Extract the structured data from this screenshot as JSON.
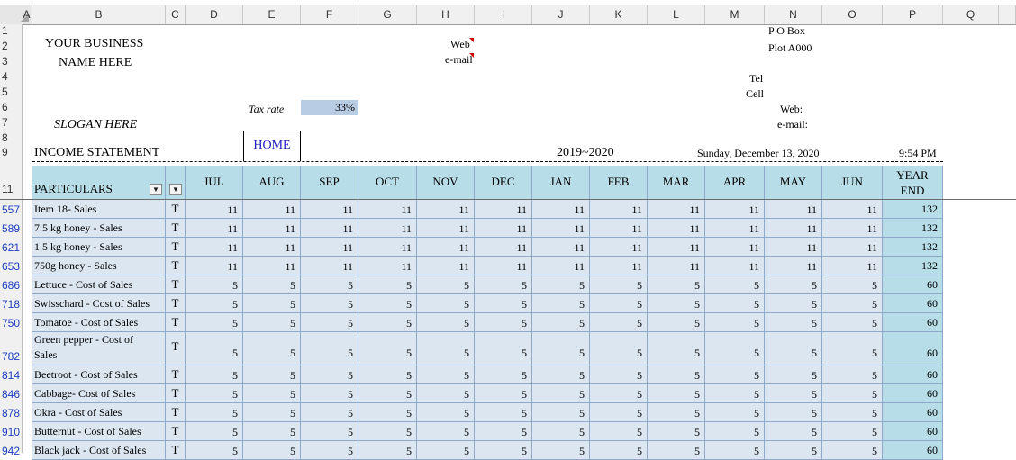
{
  "column_headers": [
    "A",
    "B",
    "C",
    "D",
    "E",
    "F",
    "G",
    "H",
    "I",
    "J",
    "K",
    "L",
    "M",
    "N",
    "O",
    "P",
    "Q"
  ],
  "row_numbers_top": [
    "1",
    "2",
    "3",
    "4",
    "5",
    "6",
    "7",
    "8",
    "9",
    "11"
  ],
  "row_numbers_data": [
    "557",
    "589",
    "621",
    "653",
    "686",
    "718",
    "750",
    "782",
    "814",
    "846",
    "878",
    "910",
    "942"
  ],
  "header": {
    "business_line1": "YOUR BUSINESS",
    "business_line2": "NAME HERE",
    "slogan": "SLOGAN HERE",
    "web_label": "Web",
    "email_label": "e-mail",
    "po_box": "P O Box",
    "plot": "Plot A000",
    "tel": "Tel",
    "cell": "Cell",
    "web_right": "Web:",
    "email_right": "e-mail:",
    "tax_rate_label": "Tax rate",
    "tax_rate_value": "33%",
    "home_button": "HOME",
    "statement_title": "INCOME STATEMENT",
    "fiscal_year": "2019~2020",
    "date": "Sunday, December 13, 2020",
    "time": "9:54 PM"
  },
  "table": {
    "particulars_header": "PARTICULARS",
    "months": [
      "JUL",
      "AUG",
      "SEP",
      "OCT",
      "NOV",
      "DEC",
      "JAN",
      "FEB",
      "MAR",
      "APR",
      "MAY",
      "JUN"
    ],
    "year_end_line1": "YEAR",
    "year_end_line2": "END",
    "rows": [
      {
        "name": "Item 18- Sales",
        "type": "T",
        "value": "11",
        "total": "132"
      },
      {
        "name": "7.5 kg honey - Sales",
        "type": "T",
        "value": "11",
        "total": "132"
      },
      {
        "name": "1.5 kg honey - Sales",
        "type": "T",
        "value": "11",
        "total": "132"
      },
      {
        "name": "750g honey - Sales",
        "type": "T",
        "value": "11",
        "total": "132"
      },
      {
        "name": "Lettuce - Cost of Sales",
        "type": "T",
        "value": "5",
        "total": "60"
      },
      {
        "name": "Swisschard - Cost of Sales",
        "type": "T",
        "value": "5",
        "total": "60"
      },
      {
        "name": "Tomatoe - Cost of Sales",
        "type": "T",
        "value": "5",
        "total": "60"
      },
      {
        "name": "Green pepper - Cost of",
        "name2": "Sales",
        "type": "T",
        "value": "5",
        "total": "60"
      },
      {
        "name": "Beetroot - Cost of Sales",
        "type": "T",
        "value": "5",
        "total": "60"
      },
      {
        "name": "Cabbage- Cost of Sales",
        "type": "T",
        "value": "5",
        "total": "60"
      },
      {
        "name": "Okra - Cost of Sales",
        "type": "T",
        "value": "5",
        "total": "60"
      },
      {
        "name": "Butternut - Cost of Sales",
        "type": "T",
        "value": "5",
        "total": "60"
      },
      {
        "name": "Black jack - Cost of Sales",
        "type": "T",
        "value": "5",
        "total": "60"
      }
    ]
  }
}
